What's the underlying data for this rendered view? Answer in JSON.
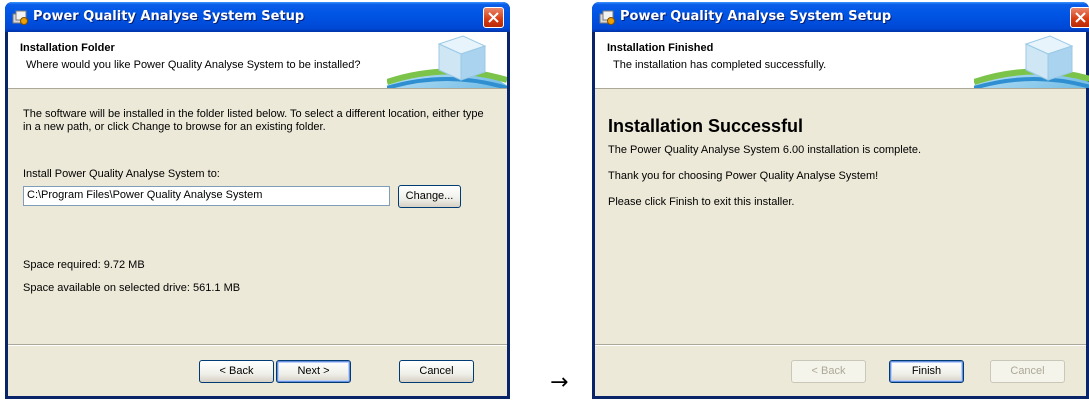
{
  "colors": {
    "titlebar": "#0055e5",
    "dialog_bg": "#ece9d8",
    "close_red": "#d63a10"
  },
  "transition_arrow": "→",
  "folder_dialog": {
    "title": "Power Quality Analyse System Setup",
    "header_title": "Installation Folder",
    "header_subtitle": "Where would you like Power Quality Analyse System to be installed?",
    "description": "The software will be installed in the folder listed below. To select a different location, either type in a new path, or click Change to browse for an existing folder.",
    "install_label": "Install Power Quality Analyse System to:",
    "install_path": "C:\\Program Files\\Power Quality Analyse System",
    "change_button": "Change...",
    "space_required": "Space required: 9.72 MB",
    "space_available": "Space available on selected drive: 561.1 MB",
    "back_button": "< Back",
    "next_button": "Next >",
    "cancel_button": "Cancel"
  },
  "finish_dialog": {
    "title": "Power Quality Analyse System Setup",
    "header_title": "Installation Finished",
    "header_subtitle": "The installation has completed successfully.",
    "success_heading": "Installation Successful",
    "line1": "The Power Quality Analyse System 6.00 installation is complete.",
    "line2": "Thank you for choosing Power Quality Analyse System!",
    "line3": "Please click Finish to exit this installer.",
    "back_button": "< Back",
    "finish_button": "Finish",
    "cancel_button": "Cancel"
  }
}
